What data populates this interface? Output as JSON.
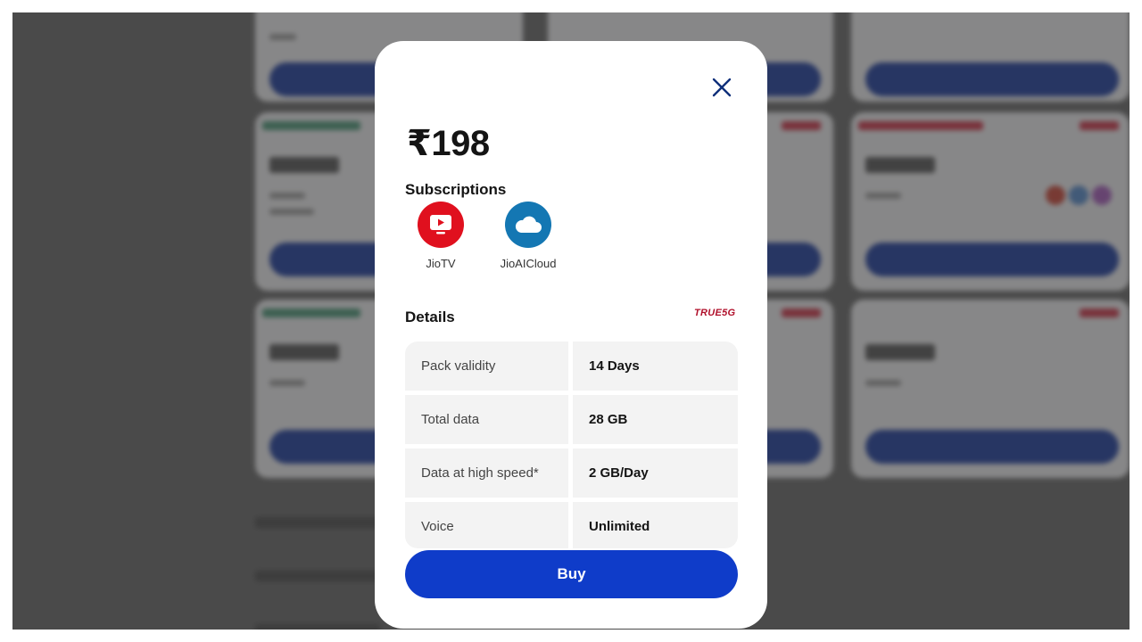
{
  "modal": {
    "price": "₹198",
    "subscriptions_title": "Subscriptions",
    "subscriptions": [
      {
        "label": "JioTV",
        "icon": "jiotv-icon",
        "color": "#e0101e"
      },
      {
        "label": "JioAICloud",
        "icon": "cloud-icon",
        "color": "#1477b3"
      }
    ],
    "details_title": "Details",
    "badge": "TRUE5G",
    "details": [
      {
        "key": "Pack validity",
        "value": "14 Days"
      },
      {
        "key": "Total data",
        "value": "28 GB"
      },
      {
        "key": "Data at high speed*",
        "value": "2 GB/Day"
      },
      {
        "key": "Voice",
        "value": "Unlimited"
      }
    ],
    "buy_label": "Buy",
    "close_icon": "close-icon"
  },
  "colors": {
    "accent": "#0f3cc9",
    "badge": "#b0102b",
    "overlay": "#5c5c5c"
  }
}
